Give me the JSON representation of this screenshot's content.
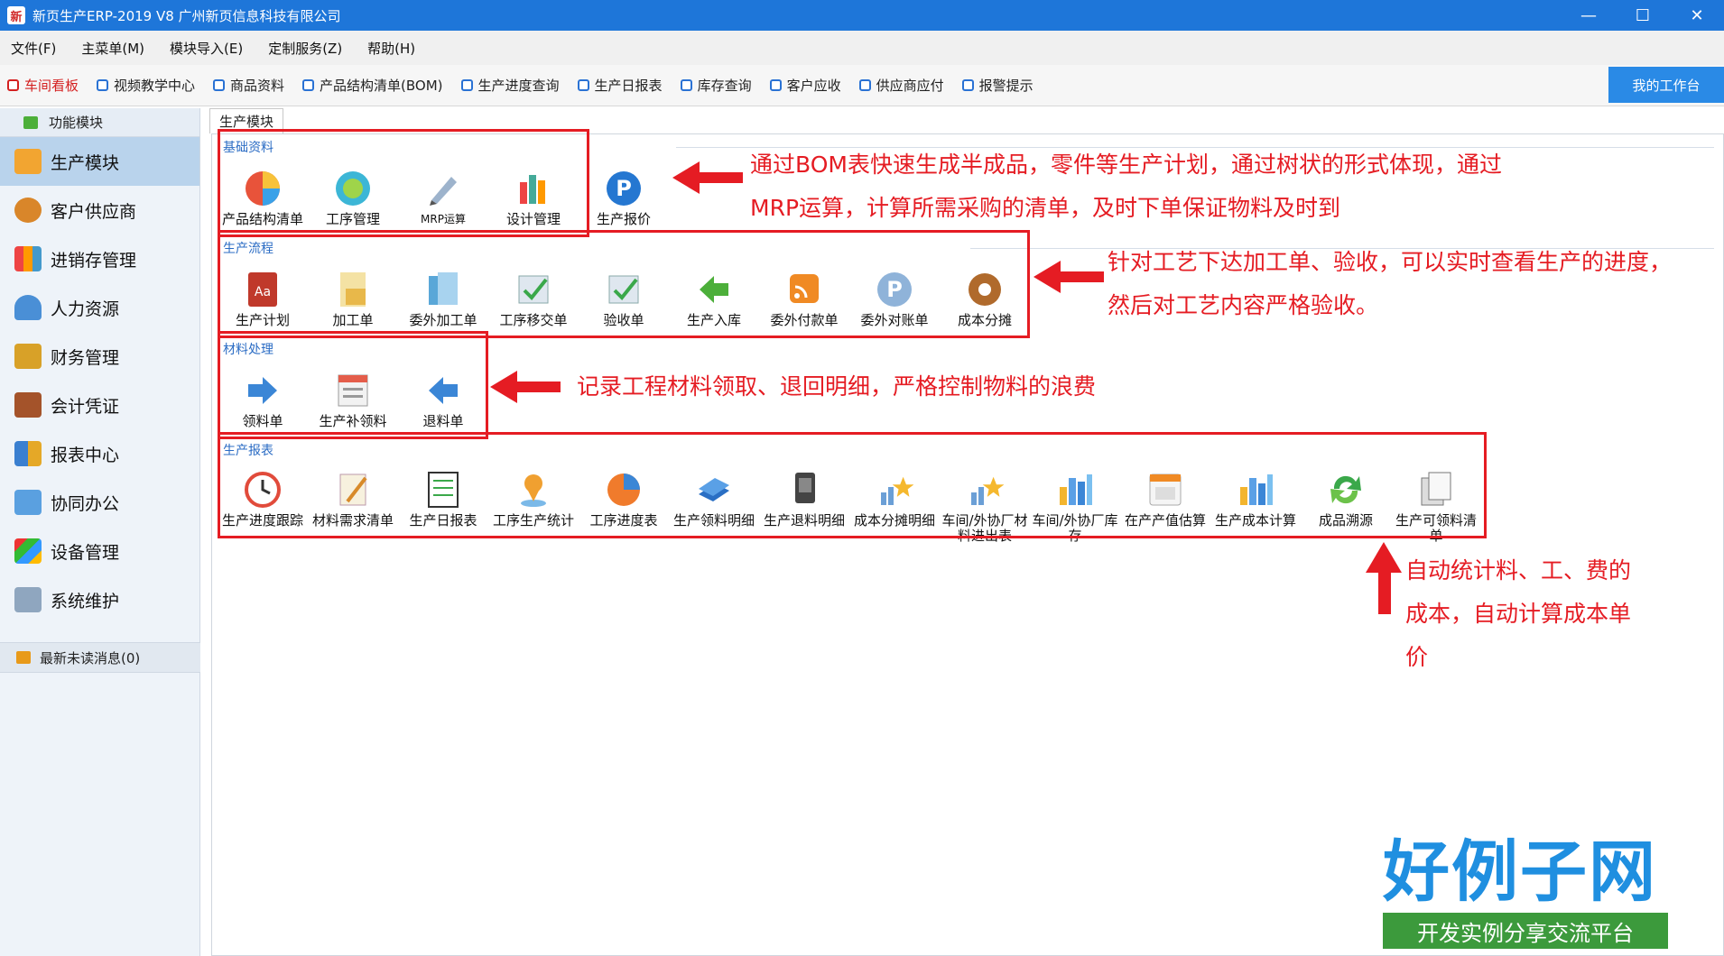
{
  "window": {
    "title": "新页生产ERP-2019 V8 广州新页信息科技有限公司",
    "controls": [
      "—",
      "☐",
      "✕"
    ]
  },
  "menu": [
    "文件(F)",
    "主菜单(M)",
    "模块导入(E)",
    "定制服务(Z)",
    "帮助(H)"
  ],
  "toolbar": {
    "items": [
      "车间看板",
      "视频教学中心",
      "商品资料",
      "产品结构清单(BOM)",
      "生产进度查询",
      "生产日报表",
      "库存查询",
      "客户应收",
      "供应商应付",
      "报警提示"
    ],
    "workbench": "我的工作台"
  },
  "sidebar": {
    "header": "功能模块",
    "items": [
      "生产模块",
      "客户供应商",
      "进销存管理",
      "人力资源",
      "财务管理",
      "会计凭证",
      "报表中心",
      "协同办公",
      "设备管理",
      "系统维护"
    ],
    "footer": "最新未读消息(0)"
  },
  "main": {
    "tab": "生产模块",
    "sections": [
      {
        "title": "基础资料",
        "items": [
          "产品结构清单",
          "工序管理",
          "MRP运算",
          "设计管理",
          "生产报价"
        ]
      },
      {
        "title": "生产流程",
        "items": [
          "生产计划",
          "加工单",
          "委外加工单",
          "工序移交单",
          "验收单",
          "生产入库",
          "委外付款单",
          "委外对账单",
          "成本分摊"
        ]
      },
      {
        "title": "材料处理",
        "items": [
          "领料单",
          "生产补领料",
          "退料单"
        ]
      },
      {
        "title": "生产报表",
        "items": [
          "生产进度跟踪",
          "材料需求清单",
          "生产日报表",
          "工序生产统计",
          "工序进度表",
          "生产领料明细",
          "生产退料明细",
          "成本分摊明细",
          "车间/外协厂材料进出表",
          "车间/外协厂库存",
          "在产产值估算",
          "生产成本计算",
          "成品溯源",
          "生产可领料清单"
        ]
      }
    ]
  },
  "annotations": {
    "a1_line1": "通过BOM表快速生成半成品，零件等生产计划，通过树状的形式体现，通过",
    "a1_line2": "MRP运算，计算所需采购的清单，及时下单保证物料及时到",
    "a2_line1": "针对工艺下达加工单、验收，可以实时查看生产的进度，",
    "a2_line2": "然后对工艺内容严格验收。",
    "a3": "记录工程材料领取、退回明细，严格控制物料的浪费",
    "a4_line1": "自动统计料、工、费的",
    "a4_line2": "成本，自动计算成本单",
    "a4_line3": "价"
  },
  "logo": {
    "main": "好例子网",
    "sub": "开发实例分享交流平台"
  }
}
